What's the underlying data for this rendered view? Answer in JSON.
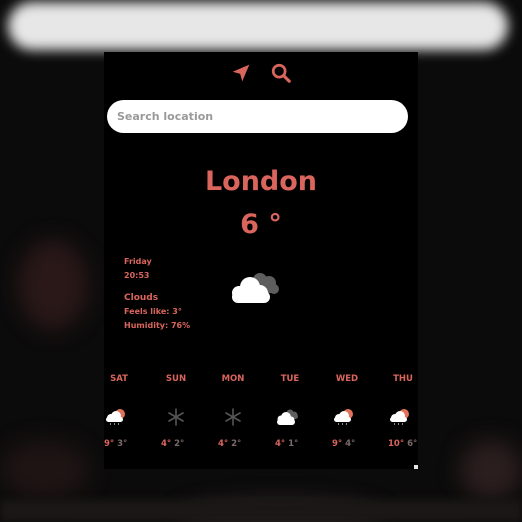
{
  "search": {
    "placeholder": "Search location",
    "value": ""
  },
  "toolbar": {
    "location_icon": "navigation-arrow-icon",
    "search_icon": "magnifier-icon"
  },
  "current": {
    "city": "London",
    "temperature": "6 °",
    "day": "Friday",
    "time": "20:53",
    "condition": "Clouds",
    "feels_like": "Feels like: 3°",
    "humidity": "Humidity: 76%",
    "icon": "clouds-icon"
  },
  "forecast": [
    {
      "day": "SAT",
      "icon": "sun-cloud-rain-icon",
      "high": "9°",
      "low": "3°"
    },
    {
      "day": "SUN",
      "icon": "snowflake-icon",
      "high": "4°",
      "low": "2°"
    },
    {
      "day": "MON",
      "icon": "snowflake-icon",
      "high": "4°",
      "low": "2°"
    },
    {
      "day": "TUE",
      "icon": "clouds-icon",
      "high": "4°",
      "low": "1°"
    },
    {
      "day": "WED",
      "icon": "sun-cloud-rain-icon",
      "high": "9°",
      "low": "4°"
    },
    {
      "day": "THU",
      "icon": "sun-cloud-rain-icon",
      "high": "10°",
      "low": "6°"
    }
  ],
  "colors": {
    "accent": "#d9655c",
    "background": "#000000",
    "muted": "#7a6a6a"
  }
}
